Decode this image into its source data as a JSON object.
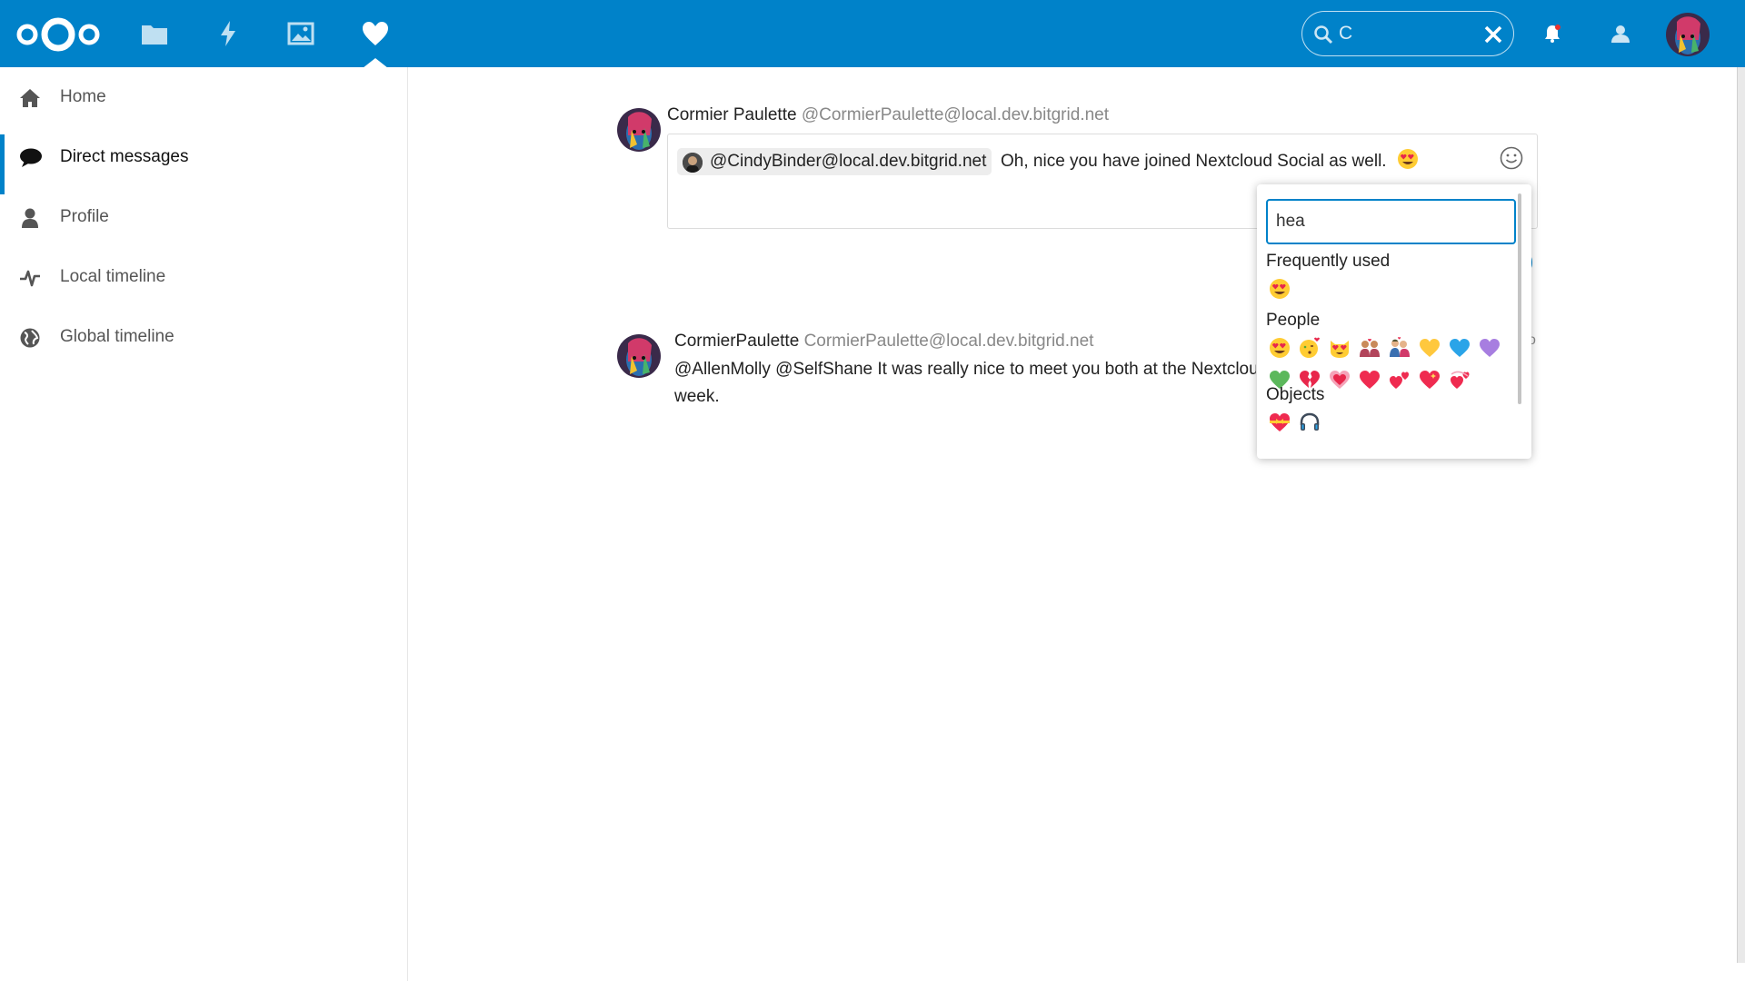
{
  "header": {
    "apps": [
      {
        "name": "files",
        "icon": "folder-icon"
      },
      {
        "name": "activity",
        "icon": "lightning-icon"
      },
      {
        "name": "gallery",
        "icon": "image-icon"
      },
      {
        "name": "social",
        "icon": "heart-icon",
        "active": true
      }
    ],
    "search": {
      "value": "C"
    },
    "accent_color": "#0082c9"
  },
  "sidebar": {
    "items": [
      {
        "label": "Home",
        "icon": "home-icon"
      },
      {
        "label": "Direct messages",
        "icon": "speech-bubble-icon",
        "active": true
      },
      {
        "label": "Profile",
        "icon": "user-icon"
      },
      {
        "label": "Local timeline",
        "icon": "pulse-icon"
      },
      {
        "label": "Global timeline",
        "icon": "globe-icon"
      }
    ]
  },
  "composer": {
    "author_name": "Cormier Paulette",
    "author_handle": "@CormierPaulette@local.dev.bitgrid.net",
    "mention": "@CindyBinder@local.dev.bitgrid.net",
    "text": "Oh, nice you have joined Nextcloud Social as well."
  },
  "emoji_picker": {
    "search_value": "hea",
    "frequently_used_label": "Frequently used",
    "people_label": "People",
    "objects_label": "Objects"
  },
  "post": {
    "author_name": "CormierPaulette",
    "author_handle": "CormierPaulette@local.dev.bitgrid.net",
    "text": "@AllenMolly @SelfShane It was really nice to meet you both at the Nextclou",
    "text_line2": "week.",
    "more": "o"
  }
}
